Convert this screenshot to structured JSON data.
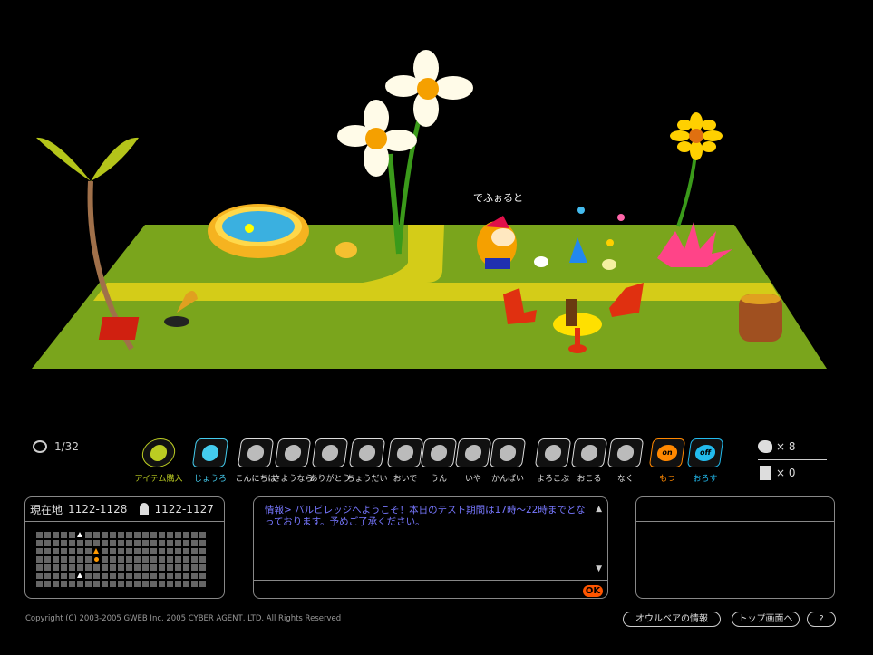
{
  "scene": {
    "character_name": "でふぉると"
  },
  "status": {
    "bear_count": "1/32"
  },
  "actions": [
    {
      "label": "アイテム購入",
      "color": "#bbcc22",
      "icon": "shop-icon"
    },
    {
      "label": "じょうろ",
      "color": "#44ccee",
      "icon": "watering-can-icon"
    },
    {
      "label": "こんにちは",
      "color": "#dddddd",
      "icon": "hello-icon"
    },
    {
      "label": "さようなら",
      "color": "#dddddd",
      "icon": "goodbye-icon"
    },
    {
      "label": "ありがとう",
      "color": "#dddddd",
      "icon": "thanks-icon"
    },
    {
      "label": "ちょうだい",
      "color": "#dddddd",
      "icon": "give-me-icon"
    },
    {
      "label": "おいで",
      "color": "#dddddd",
      "icon": "come-here-icon"
    },
    {
      "label": "うん",
      "color": "#dddddd",
      "icon": "yes-icon"
    },
    {
      "label": "いや",
      "color": "#dddddd",
      "icon": "no-icon"
    },
    {
      "label": "かんぱい",
      "color": "#dddddd",
      "icon": "cheers-icon"
    },
    {
      "label": "よろこぶ",
      "color": "#dddddd",
      "icon": "happy-icon"
    },
    {
      "label": "おこる",
      "color": "#dddddd",
      "icon": "angry-icon"
    },
    {
      "label": "なく",
      "color": "#dddddd",
      "icon": "cry-icon"
    },
    {
      "label": "もつ",
      "color": "#ff8800",
      "icon": "on-icon",
      "badge": "on"
    },
    {
      "label": "おろす",
      "color": "#22bbee",
      "icon": "off-icon",
      "badge": "off"
    }
  ],
  "inventory": {
    "bird_count": "× 8",
    "wheat_count": "× 0"
  },
  "location": {
    "label": "現在地",
    "current": "1122-1128",
    "home": "1122-1127"
  },
  "chat": {
    "message": "情報> バルビレッジへようこそ！本日のテスト期間は17時〜22時までとなっております。予めご了承ください。",
    "ok_label": "OK"
  },
  "footer": {
    "copyright": "Copyright (C) 2003-2005 GWEB Inc. 2005 CYBER AGENT, LTD. All Rights Reserved",
    "owlbear_info": "オウルベアの情報",
    "top_page": "トップ画面へ",
    "help": "?"
  }
}
